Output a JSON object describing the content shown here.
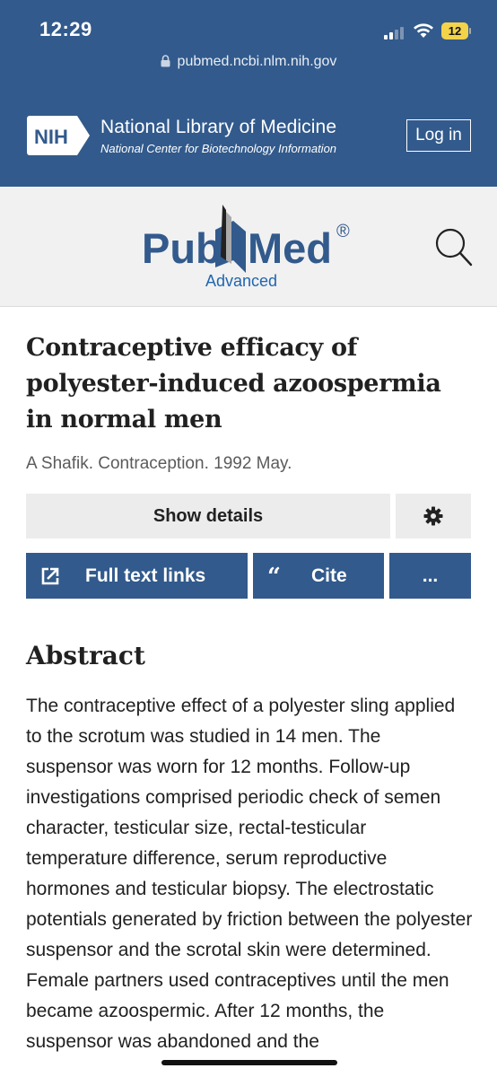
{
  "status_bar": {
    "time": "12:29",
    "battery_level": "12",
    "signal_icon": "cellular-signal-icon",
    "wifi_icon": "wifi-icon"
  },
  "browser": {
    "url": "pubmed.ncbi.nlm.nih.gov"
  },
  "header": {
    "logo_text": "NIH",
    "title": "National Library of Medicine",
    "subtitle": "National Center for Biotechnology Information",
    "login_label": "Log in",
    "background_color": "#325a8c"
  },
  "pubmed": {
    "logo_text_left": "Pub",
    "logo_text_right": "Med",
    "registered_mark": "®",
    "advanced_label": "Advanced",
    "search_icon": "search-icon"
  },
  "article": {
    "title": "Contraceptive efficacy of polyester-induced azoospermia in normal men",
    "meta": "A Shafik. Contraception. 1992 May.",
    "show_details_label": "Show details",
    "full_text_label": "Full text links",
    "cite_label": "Cite",
    "cite_icon_glyph": "“",
    "more_label": "...",
    "abstract_heading": "Abstract",
    "abstract_text": "The contraceptive effect of a polyester sling applied to the scrotum was studied in 14 men. The suspensor was worn for 12 months. Follow-up investigations comprised periodic check of semen character, testicular size, rectal-testicular temperature difference, serum reproductive hormones and testicular biopsy. The electrostatic potentials generated by friction between the polyester suspensor and the scrotal skin were determined. Female partners used contraceptives until the men became azoospermic. After 12 months, the suspensor was abandoned and the",
    "accent_color": "#325a8c",
    "link_color": "#2066b0"
  }
}
